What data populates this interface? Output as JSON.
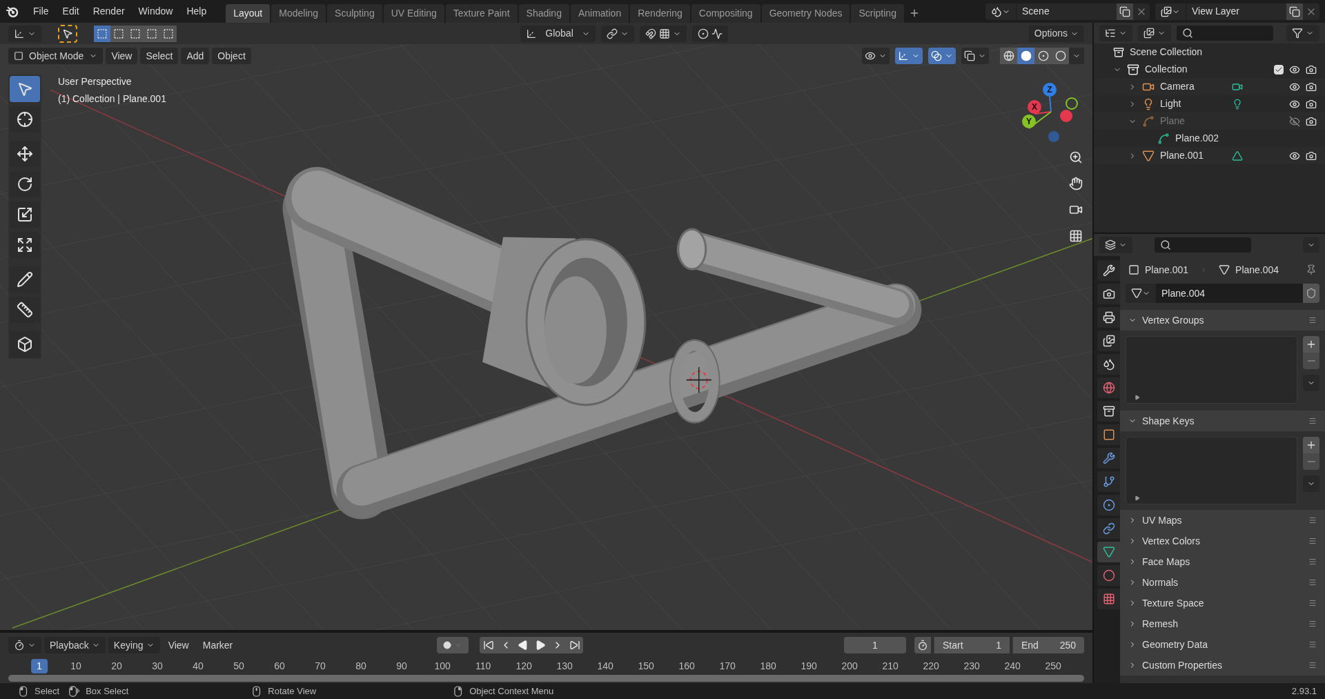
{
  "menu": [
    "File",
    "Edit",
    "Render",
    "Window",
    "Help"
  ],
  "workspaces": [
    {
      "label": "Layout",
      "selected": true
    },
    {
      "label": "Modeling",
      "selected": false
    },
    {
      "label": "Sculpting",
      "selected": false
    },
    {
      "label": "UV Editing",
      "selected": false
    },
    {
      "label": "Texture Paint",
      "selected": false
    },
    {
      "label": "Shading",
      "selected": false
    },
    {
      "label": "Animation",
      "selected": false
    },
    {
      "label": "Rendering",
      "selected": false
    },
    {
      "label": "Compositing",
      "selected": false
    },
    {
      "label": "Geometry Nodes",
      "selected": false
    },
    {
      "label": "Scripting",
      "selected": false
    }
  ],
  "scene": "Scene",
  "view_layer": "View Layer",
  "tool_header": {
    "select_modes": [
      {
        "selected": true
      },
      {
        "selected": false
      },
      {
        "selected": false
      },
      {
        "selected": false
      },
      {
        "selected": false
      }
    ],
    "orientation": "Global",
    "options": "Options"
  },
  "viewport_header": {
    "mode": "Object Mode",
    "menus": [
      "View",
      "Select",
      "Add",
      "Object"
    ],
    "toggles": [
      {
        "kind": "visibility",
        "on": false
      },
      {
        "kind": "gizmo",
        "on": true
      },
      {
        "kind": "overlay",
        "on": true
      },
      {
        "kind": "xray",
        "on": false
      }
    ],
    "shading": [
      {
        "kind": "wireframe",
        "selected": false
      },
      {
        "kind": "solid",
        "selected": true
      },
      {
        "kind": "material",
        "selected": false
      },
      {
        "kind": "rendered",
        "selected": false
      }
    ]
  },
  "viewport": {
    "view_name": "User Perspective",
    "context": "(1) Collection | Plane.001",
    "tools": [
      {
        "kind": "select",
        "selected": true
      },
      {
        "kind": "cursor",
        "selected": false
      },
      {
        "kind": "move",
        "selected": false
      },
      {
        "kind": "rotate",
        "selected": false
      },
      {
        "kind": "scale",
        "selected": false
      },
      {
        "kind": "transform",
        "selected": false
      },
      {
        "kind": "annotate",
        "selected": false
      },
      {
        "kind": "measure",
        "selected": false
      },
      {
        "kind": "add_cube",
        "selected": false
      }
    ],
    "axes": [
      {
        "label": "Z",
        "color": "#2f7fe6"
      },
      {
        "label": "X",
        "color": "#e5384f"
      },
      {
        "label": "Y",
        "color": "#84c226"
      }
    ]
  },
  "outliner": {
    "root": "Scene Collection",
    "items": [
      {
        "name": "Collection",
        "kind": "collection",
        "expanded": true,
        "checked": true,
        "visible": true,
        "children": [
          {
            "name": "Camera",
            "kind": "camera",
            "expanded": false,
            "visible": true
          },
          {
            "name": "Light",
            "kind": "light",
            "expanded": false,
            "visible": true
          },
          {
            "name": "Plane",
            "kind": "curve",
            "expanded": true,
            "visible": false,
            "children": [
              {
                "name": "Plane.002",
                "kind": "curve_data"
              }
            ]
          },
          {
            "name": "Plane.001",
            "kind": "mesh",
            "expanded": false,
            "visible": true
          }
        ]
      }
    ]
  },
  "properties": {
    "tabs": [
      {
        "kind": "tool",
        "selected": false
      },
      {
        "kind": "render",
        "selected": false
      },
      {
        "kind": "output",
        "selected": false
      },
      {
        "kind": "view_layer",
        "selected": false
      },
      {
        "kind": "scene",
        "selected": false
      },
      {
        "kind": "world",
        "selected": false
      },
      {
        "kind": "collection",
        "selected": false
      },
      {
        "kind": "object",
        "selected": false
      },
      {
        "kind": "modifiers",
        "selected": false
      },
      {
        "kind": "particles",
        "selected": false
      },
      {
        "kind": "physics",
        "selected": false
      },
      {
        "kind": "constraints",
        "selected": false
      },
      {
        "kind": "data",
        "selected": true
      },
      {
        "kind": "material",
        "selected": false
      },
      {
        "kind": "texture",
        "selected": false
      }
    ],
    "object": "Plane.001",
    "data": "Plane.004",
    "data_field": "Plane.004",
    "panels": [
      {
        "title": "Vertex Groups",
        "expanded": true
      },
      {
        "title": "Shape Keys",
        "expanded": true
      },
      {
        "title": "UV Maps",
        "expanded": false
      },
      {
        "title": "Vertex Colors",
        "expanded": false
      },
      {
        "title": "Face Maps",
        "expanded": false
      },
      {
        "title": "Normals",
        "expanded": false
      },
      {
        "title": "Texture Space",
        "expanded": false
      },
      {
        "title": "Remesh",
        "expanded": false
      },
      {
        "title": "Geometry Data",
        "expanded": false
      },
      {
        "title": "Custom Properties",
        "expanded": false
      }
    ]
  },
  "timeline": {
    "menus": [
      "Playback",
      "Keying",
      "View",
      "Marker"
    ],
    "current_frame": "1",
    "start_label": "Start",
    "start": "1",
    "end_label": "End",
    "end": "250",
    "ticks": [
      "1",
      "10",
      "20",
      "30",
      "40",
      "50",
      "60",
      "70",
      "80",
      "90",
      "100",
      "110",
      "120",
      "130",
      "140",
      "150",
      "160",
      "170",
      "180",
      "190",
      "200",
      "210",
      "220",
      "230",
      "240",
      "250"
    ]
  },
  "status_bar": {
    "hints": [
      {
        "label": "Select",
        "kind": "left"
      },
      {
        "label": "Box Select",
        "kind": "drag"
      },
      {
        "label": "Rotate View",
        "kind": "middle"
      },
      {
        "label": "Object Context Menu",
        "kind": "right"
      }
    ],
    "version": "2.93.1"
  }
}
